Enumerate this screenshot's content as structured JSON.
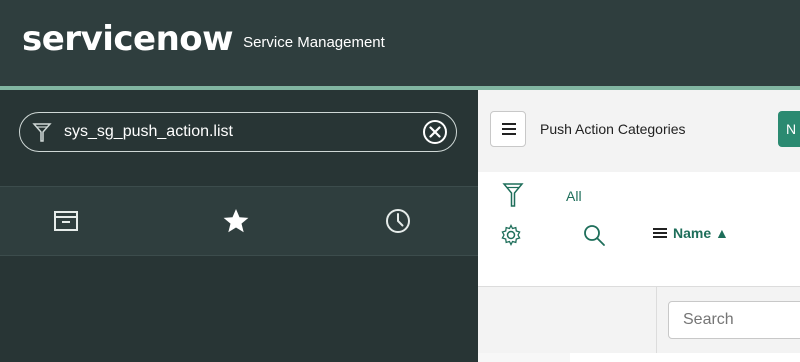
{
  "header": {
    "logo_text": "servicenow",
    "app_name": "Service Management"
  },
  "sidebar": {
    "filter": {
      "value": "sys_sg_push_action.list"
    },
    "tabs": [
      {
        "icon": "archive-icon"
      },
      {
        "icon": "star-icon"
      },
      {
        "icon": "clock-icon"
      }
    ]
  },
  "list": {
    "title": "Push Action Categories",
    "new_button_label": "N",
    "breadcrumb": "All",
    "column_header": "Name ▲",
    "search_placeholder": "Search"
  },
  "colors": {
    "header_bg": "#2f3e3e",
    "accent_line": "#81b5a1",
    "brand_green": "#2b8a71",
    "link_green": "#1e6e5a"
  }
}
